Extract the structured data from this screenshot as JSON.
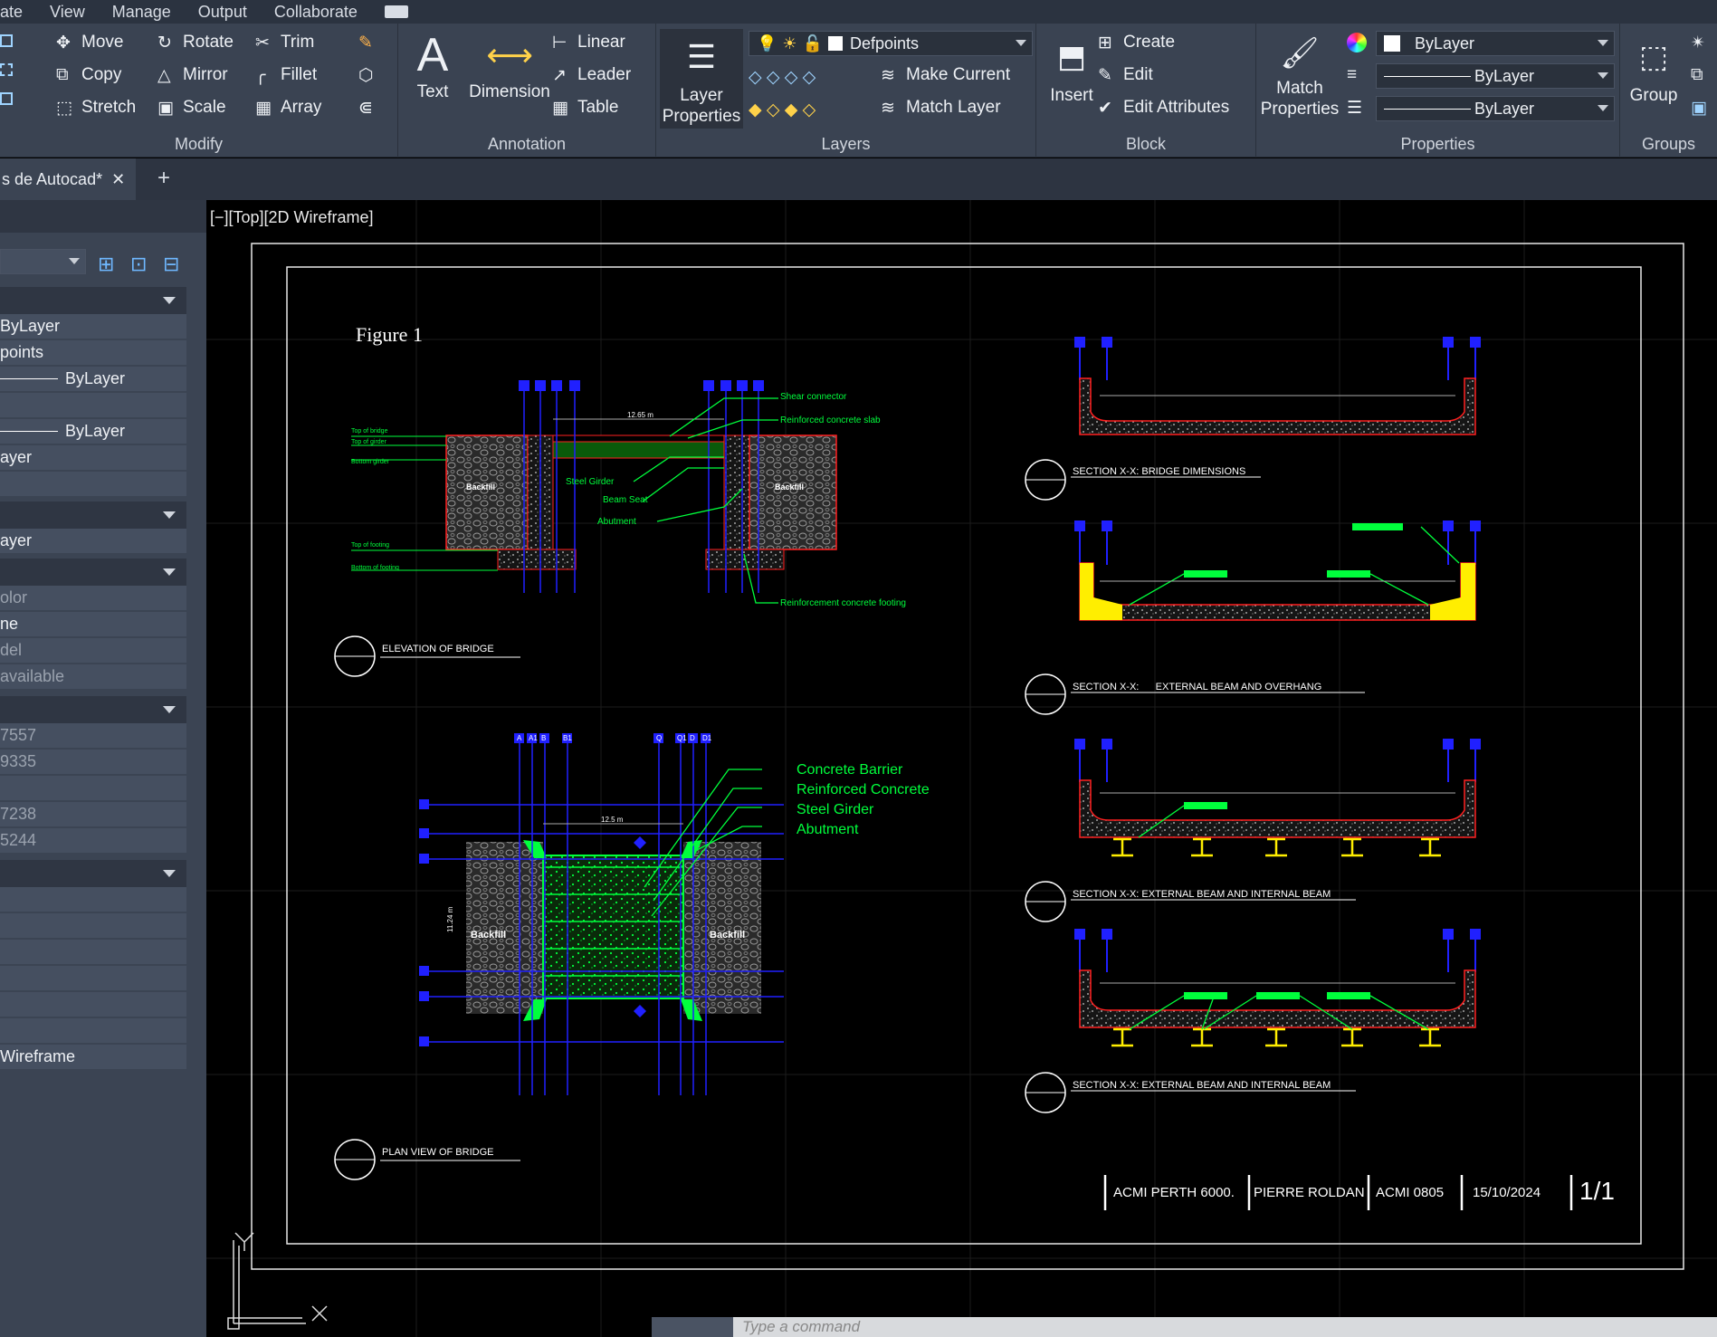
{
  "menu": [
    "ate",
    "View",
    "Manage",
    "Output",
    "Collaborate"
  ],
  "ribbon": {
    "modify": {
      "title": "Modify",
      "move": "Move",
      "rotate": "Rotate",
      "trim": "Trim",
      "copy": "Copy",
      "mirror": "Mirror",
      "fillet": "Fillet",
      "stretch": "Stretch",
      "scale": "Scale",
      "array": "Array"
    },
    "annotation": {
      "title": "Annotation",
      "text": "Text",
      "dimension": "Dimension",
      "linear": "Linear",
      "leader": "Leader",
      "table": "Table"
    },
    "layers": {
      "title": "Layers",
      "layer_properties_1": "Layer",
      "layer_properties_2": "Properties",
      "current_layer": "Defpoints",
      "make_current": "Make Current",
      "match_layer": "Match Layer"
    },
    "block": {
      "title": "Block",
      "insert": "Insert",
      "create": "Create",
      "edit": "Edit",
      "edit_attributes": "Edit Attributes"
    },
    "properties": {
      "title": "Properties",
      "match_1": "Match",
      "match_2": "Properties",
      "color": "ByLayer",
      "linetype": "ByLayer",
      "lineweight": "ByLayer"
    },
    "groups": {
      "title": "Groups",
      "group": "Group"
    }
  },
  "tabs": {
    "doc": "s de Autocad*",
    "close": "✕",
    "new": "+"
  },
  "left_panel": {
    "rows": [
      "ByLayer",
      "points",
      "ByLayer",
      "ByLayer",
      "ayer",
      "ayer",
      "olor",
      "ne",
      "del",
      "available",
      "7557",
      "9335",
      "7238",
      "5244",
      "Wireframe"
    ]
  },
  "viewport": {
    "label": "[−][Top][2D Wireframe]",
    "cmd_placeholder": "Type a command"
  },
  "drawing": {
    "figure_title": "Figure  1",
    "elevation_title": "ELEVATION OF BRIDGE",
    "plan_title": "PLAN VIEW OF BRIDGE",
    "elev_labels": [
      "Shear connector",
      "Reinforced concrete slab",
      "Steel Girder",
      "Beam Seat",
      "Abutment",
      "Reinforcement concrete footing"
    ],
    "elev_left": [
      "Top of bridge",
      "Top of girder",
      "Bottom girder",
      "Top of footing",
      "Bottom of footing"
    ],
    "backfill": "Backfill",
    "dim_span": "12.65 m",
    "plan_legend": [
      "Concrete Barrier",
      "Reinforced Concrete",
      "Steel Girder",
      "Abutment"
    ],
    "plan_span": "12.5 m",
    "plan_width": "11.24 m",
    "grid_top": [
      "A",
      "A1",
      "B",
      "B1"
    ],
    "grid_top2": [
      "Q",
      "Q1",
      "D",
      "D1"
    ],
    "sections": [
      "SECTION X-X: BRIDGE DIMENSIONS",
      "SECTION X-X:      EXTERNAL BEAM AND OVERHANG",
      "SECTION X-X: EXTERNAL BEAM AND INTERNAL BEAM",
      "SECTION X-X: EXTERNAL BEAM AND INTERNAL BEAM"
    ],
    "title_block": [
      "ACMI PERTH 6000.",
      "PIERRE ROLDAN",
      "ACMI 0805",
      "15/10/2024",
      "1/1"
    ]
  },
  "colors": {
    "accent_green": "#00ff3c",
    "grid_blue": "#2020ff",
    "yellow": "#ffee00",
    "red": "#ff2020"
  }
}
